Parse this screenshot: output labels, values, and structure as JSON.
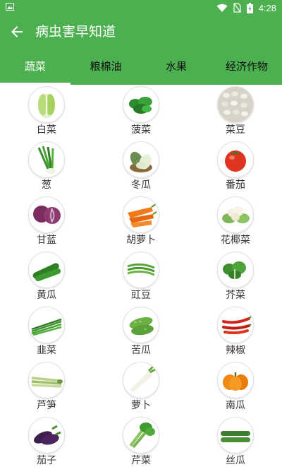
{
  "status_bar": {
    "time": "4:28"
  },
  "header": {
    "title": "病虫害早知道"
  },
  "tabs": [
    {
      "label": "蔬菜",
      "active": true
    },
    {
      "label": "粮棉油",
      "active": false
    },
    {
      "label": "水果",
      "active": false
    },
    {
      "label": "经济作物",
      "active": false
    }
  ],
  "vegetables": [
    {
      "name": "白菜",
      "icon": "napa-cabbage-icon"
    },
    {
      "name": "菠菜",
      "icon": "spinach-icon"
    },
    {
      "name": "菜豆",
      "icon": "beans-icon"
    },
    {
      "name": "葱",
      "icon": "scallion-icon"
    },
    {
      "name": "冬瓜",
      "icon": "winter-melon-icon"
    },
    {
      "name": "番茄",
      "icon": "tomato-icon"
    },
    {
      "name": "甘蓝",
      "icon": "red-cabbage-icon"
    },
    {
      "name": "胡萝卜",
      "icon": "carrot-icon"
    },
    {
      "name": "花椰菜",
      "icon": "cauliflower-icon"
    },
    {
      "name": "黄瓜",
      "icon": "cucumber-icon"
    },
    {
      "name": "豇豆",
      "icon": "long-bean-icon"
    },
    {
      "name": "芥菜",
      "icon": "mustard-greens-icon"
    },
    {
      "name": "韭菜",
      "icon": "chives-icon"
    },
    {
      "name": "苦瓜",
      "icon": "bitter-melon-icon"
    },
    {
      "name": "辣椒",
      "icon": "chili-pepper-icon"
    },
    {
      "name": "芦笋",
      "icon": "asparagus-icon"
    },
    {
      "name": "萝卜",
      "icon": "radish-icon"
    },
    {
      "name": "南瓜",
      "icon": "pumpkin-icon"
    },
    {
      "name": "茄子",
      "icon": "eggplant-icon"
    },
    {
      "name": "芹菜",
      "icon": "celery-icon"
    },
    {
      "name": "丝瓜",
      "icon": "loofah-icon"
    }
  ],
  "colors": {
    "primary": "#4caf50",
    "tab_active": "#ffffff",
    "tab_inactive": "#111111",
    "label": "#333333"
  }
}
